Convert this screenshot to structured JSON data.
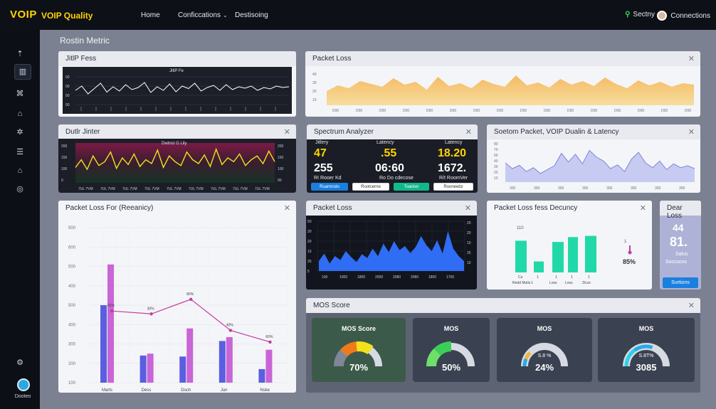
{
  "topbar": {
    "logo": "VOIP",
    "app_name": "VOIP Quality",
    "nav": {
      "home": "Home",
      "config": "Conficcations",
      "dashboard": "Destisoing"
    },
    "search_label": "Sectny",
    "connections_label": "Connections"
  },
  "sidebar": {
    "icons": [
      "home-icon",
      "dashboard-icon",
      "network-icon",
      "chart-icon",
      "settings-icon",
      "report-icon",
      "house-icon",
      "globe-icon",
      "gear-icon"
    ],
    "user_label": "Dooteo"
  },
  "main": {
    "title": "Rostin Metric"
  },
  "jitter_loss": {
    "title": "JitlP Fess",
    "chart_title": "JitlP Fe",
    "y_ticks": [
      "00",
      "00",
      "00",
      "00"
    ],
    "chart_data": {
      "type": "line",
      "values": [
        50,
        62,
        40,
        55,
        70,
        45,
        60,
        48,
        66,
        52,
        58,
        72,
        44,
        60,
        50,
        68,
        46,
        62,
        55,
        70,
        48,
        58,
        64,
        50,
        66,
        52,
        60,
        56,
        62,
        50,
        58,
        54,
        62,
        58,
        60
      ],
      "ylim": [
        0,
        100
      ]
    }
  },
  "packet_loss_top": {
    "title": "Packet Loss",
    "x_ticks": [
      "D00",
      "D00",
      "D00",
      "D00",
      "D00",
      "D00",
      "D00",
      "D00",
      "D00",
      "D00",
      "D00",
      "D00",
      "D00",
      "D00",
      "D00",
      "D00"
    ],
    "y_ticks": [
      "40",
      "30",
      "20",
      "10"
    ],
    "chart_data": {
      "type": "area",
      "values": [
        20,
        28,
        24,
        34,
        30,
        26,
        38,
        29,
        33,
        22,
        40,
        27,
        31,
        24,
        36,
        30,
        26,
        42,
        28,
        32,
        25,
        37,
        29,
        34,
        27,
        39,
        30,
        24,
        35,
        28,
        33,
        26,
        31,
        29
      ],
      "ylim": [
        0,
        50
      ]
    }
  },
  "dual_jitter": {
    "title": "Dutlr Jinter",
    "chart_title": "Dwtnst G Lily",
    "y_left": [
      "200",
      "150",
      "100",
      "0"
    ],
    "y_right": [
      "200",
      "150",
      "100",
      "90"
    ],
    "x_ticks": [
      "7UL 7VM",
      "7UL 7VM",
      "7UL 7VM",
      "7UL 7VM",
      "7UL 7VM",
      "7UL 7VM",
      "7UL 7VM",
      "7UL 7VM",
      "7UL 7VM"
    ],
    "chart_data": {
      "type": "line",
      "values": [
        80,
        120,
        70,
        140,
        90,
        110,
        160,
        75,
        130,
        95,
        150,
        85,
        120,
        100,
        170,
        80,
        140,
        110,
        90,
        160,
        120,
        100,
        145,
        85,
        175,
        95,
        130,
        110,
        150,
        90,
        120,
        140,
        100,
        165,
        110
      ],
      "ylim": [
        0,
        200
      ]
    }
  },
  "spectrum": {
    "title": "Spectrum Analyzer",
    "cols": [
      {
        "head": "Jitlery",
        "v1": "47",
        "v2": "255",
        "lbl": "RI Rooer Kd",
        "pill": "Ruamnoto"
      },
      {
        "head": "Latency",
        "v1": ".55",
        "v2": "06:60",
        "lbl": "Ro Do cdecose",
        "pill": "Rootcerne"
      },
      {
        "head": "Latency",
        "v1": "18.20",
        "v2": "1672.",
        "lbl": "R/t RoomVer",
        "pill": "Rooneebz"
      }
    ],
    "pill2": "Toacker"
  },
  "spectrum_packet": {
    "title": "Soetom Packet, VOIP Dualin & Latency",
    "y_ticks": [
      "80",
      "70",
      "60",
      "40",
      "30",
      "20",
      "10"
    ],
    "x_ticks": [
      "300",
      "300",
      "300",
      "300",
      "300",
      "300",
      "300",
      "300"
    ],
    "chart_data": {
      "type": "area",
      "values": [
        40,
        28,
        35,
        22,
        30,
        18,
        26,
        34,
        60,
        42,
        58,
        38,
        66,
        52,
        44,
        28,
        36,
        22,
        48,
        62,
        40,
        30,
        44,
        26,
        38,
        30,
        34,
        28
      ],
      "ylim": [
        0,
        80
      ]
    }
  },
  "packet_loss_freq": {
    "title": "Packet Loss For (Reeanicy)",
    "y_ticks": [
      "500",
      "600",
      "500",
      "400",
      "500",
      "400",
      "300",
      "200",
      "100"
    ],
    "x_ticks": [
      "Marts",
      "Dess",
      "Doch",
      "Jun",
      "Nske"
    ],
    "point_labels": [
      "50%",
      "30%",
      "80%",
      "40%",
      "60%"
    ],
    "chart_data": {
      "type": "bar",
      "categories": [
        "Marts",
        "Dess",
        "Doch",
        "Jun",
        "Nske"
      ],
      "series": [
        {
          "values": [
            400,
            140,
            135,
            215,
            70
          ]
        },
        {
          "values": [
            610,
            150,
            280,
            235,
            170
          ]
        }
      ],
      "line": [
        370,
        355,
        430,
        270,
        210
      ],
      "ylim": [
        0,
        800
      ]
    }
  },
  "packet_loss_dark": {
    "title": "Packet Loss",
    "y_left": [
      "50",
      "20",
      "20",
      "10",
      "25",
      "5"
    ],
    "y_right": [
      "20",
      "20",
      "10",
      "25",
      "10"
    ],
    "x_ticks": [
      "100",
      "1000",
      "1800",
      "2000",
      "2080",
      "2080",
      "1800",
      "1700"
    ],
    "chart_data": {
      "type": "area",
      "values": [
        20,
        35,
        15,
        30,
        22,
        40,
        28,
        18,
        34,
        26,
        45,
        30,
        55,
        38,
        60,
        42,
        50,
        36,
        48,
        70,
        52,
        40,
        62,
        35,
        80,
        45,
        30,
        20
      ],
      "ylim": [
        0,
        100
      ]
    }
  },
  "packet_loss_decency": {
    "title": "Packet Loss fess Decuncy",
    "bar_label": "110",
    "x_ticks": [
      "Cu",
      "1",
      "1",
      "1",
      "1"
    ],
    "x_sub": [
      "Redd Mutis",
      "1",
      "Loss",
      "Loss",
      "Zicce"
    ],
    "side_value": "85%",
    "chart_data": {
      "type": "bar",
      "values": [
        52,
        18,
        50,
        58,
        60
      ],
      "ylim": [
        0,
        70
      ]
    }
  },
  "dear_loss": {
    "title": "Dear Loss",
    "v1": "44",
    "v2": "81.",
    "sub": "Salus",
    "sub2": "Soccsovs",
    "button": "Surtions"
  },
  "mos": {
    "title": "MOS Score",
    "gauges": [
      {
        "title": "MOS Score",
        "value": "70%",
        "sub": "",
        "level": 0.7,
        "bg": "#3c5a4a"
      },
      {
        "title": "MOS",
        "value": "50%",
        "sub": "",
        "level": 0.5,
        "bg": "#3a4150"
      },
      {
        "title": "MOS",
        "value": "24%",
        "sub": "S.8 %",
        "level": 0.24,
        "bg": "#3a4150"
      },
      {
        "title": "MOS",
        "value": "3085",
        "sub": "S.8T%",
        "level": 0.6,
        "bg": "#3a4150"
      }
    ]
  }
}
